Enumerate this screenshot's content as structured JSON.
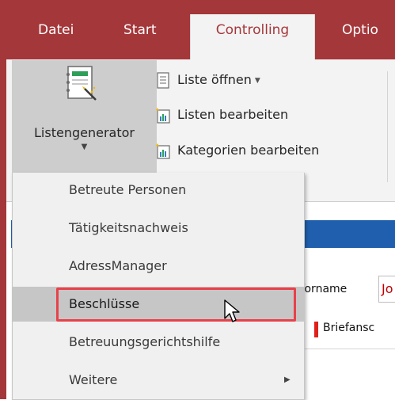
{
  "ribbon_tabs": [
    {
      "label": "Datei"
    },
    {
      "label": "Start"
    },
    {
      "label": "Controlling"
    },
    {
      "label": "Optio"
    }
  ],
  "ribbon": {
    "big_button_label": "Listengenerator",
    "commands": [
      {
        "label": "Liste öffnen",
        "icon": "list-document-icon",
        "has_dropdown": true
      },
      {
        "label": "Listen bearbeiten",
        "icon": "edit-list-icon"
      },
      {
        "label": "Kategorien bearbeiten",
        "icon": "edit-categories-icon"
      }
    ]
  },
  "menu": {
    "items": [
      {
        "label": "Betreute Personen"
      },
      {
        "label": "Tätigkeitsnachweis"
      },
      {
        "label": "AdressManager"
      },
      {
        "label": "Beschlüsse",
        "hovered": true
      },
      {
        "label": "Betreuungsgerichtshilfe"
      },
      {
        "label": "Weitere",
        "has_submenu": true
      }
    ]
  },
  "background": {
    "field_label": "Vorname",
    "field_value": "Jo",
    "brief_label": "Briefansc"
  },
  "colors": {
    "accent": "#a4373a",
    "highlight": "#e8414a",
    "blue_bar": "#1f5fae"
  }
}
